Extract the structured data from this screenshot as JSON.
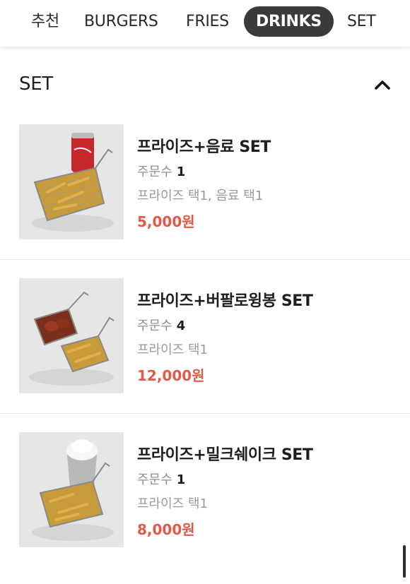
{
  "tabs": [
    {
      "label": "추천",
      "active": false
    },
    {
      "label": "BURGERS",
      "active": false
    },
    {
      "label": "FRIES",
      "active": false
    },
    {
      "label": "DRINKS",
      "active": true
    },
    {
      "label": "SET",
      "active": false
    }
  ],
  "section": {
    "title": "SET",
    "collapse_icon": "chevron-up-icon"
  },
  "items": [
    {
      "name": "프라이즈+음료 SET",
      "orders_label": "주문수",
      "orders_count": "1",
      "options": "프라이즈 택1, 음료 택1",
      "price": "5,000원",
      "image": "fries-and-cola-photo"
    },
    {
      "name": "프라이즈+버팔로윙봉 SET",
      "orders_label": "주문수",
      "orders_count": "4",
      "options": "프라이즈 택1",
      "price": "12,000원",
      "image": "fries-and-wings-photo"
    },
    {
      "name": "프라이즈+밀크쉐이크 SET",
      "orders_label": "주문수",
      "orders_count": "1",
      "options": "프라이즈 택1",
      "price": "8,000원",
      "image": "fries-and-milkshake-photo"
    }
  ],
  "colors": {
    "price": "#e05a47",
    "active_tab_bg": "#3a3a3a",
    "muted_text": "#8f8f8f"
  }
}
